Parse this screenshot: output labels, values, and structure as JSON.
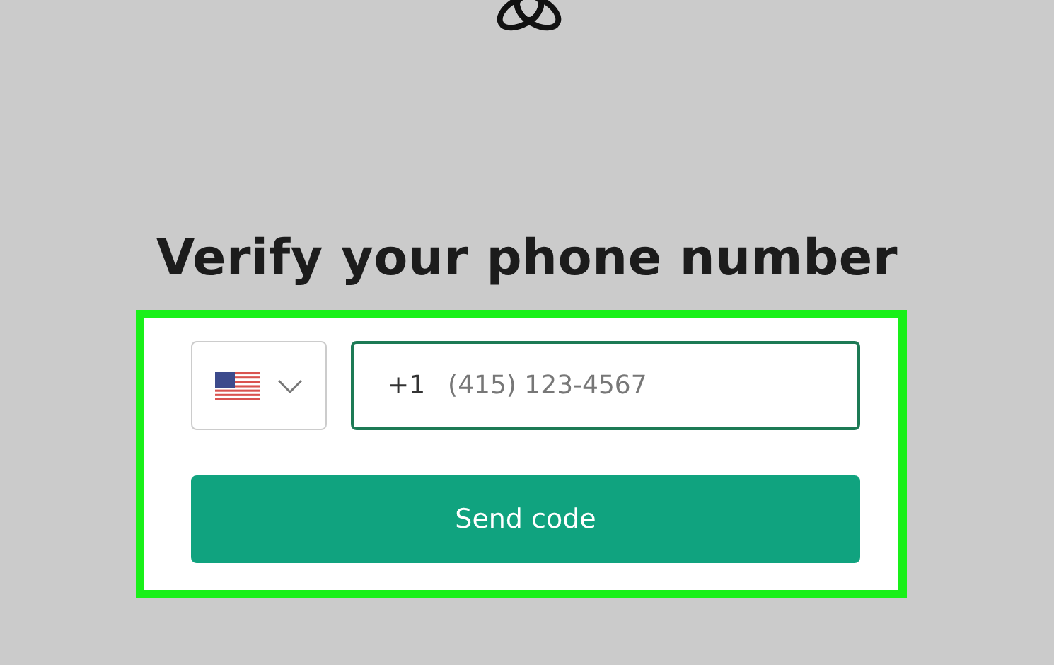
{
  "title": "Verify your phone number",
  "phone": {
    "country_code": "+1",
    "placeholder": "(415) 123-4567"
  },
  "button": "Send code"
}
